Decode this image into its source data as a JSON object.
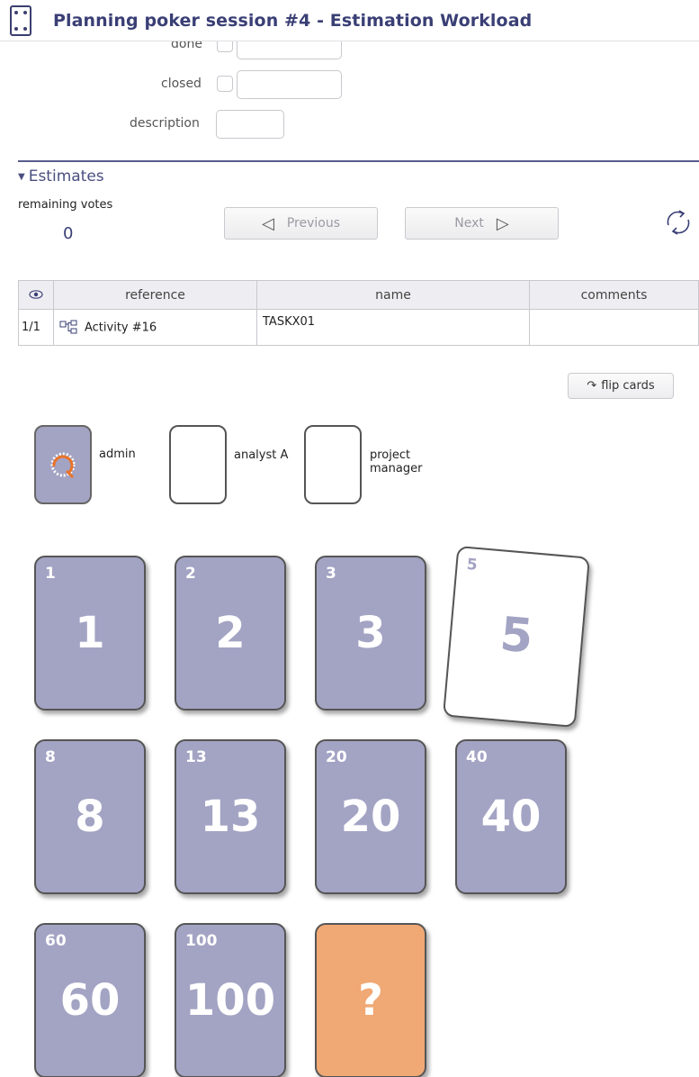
{
  "header": {
    "title": "Planning poker session  #4  - Estimation Workload"
  },
  "form": {
    "done_label": "done",
    "closed_label": "closed",
    "description_label": "description"
  },
  "estimates": {
    "section_title": "Estimates",
    "remaining_votes_label": "remaining votes",
    "remaining_votes_count": "0",
    "previous_label": "Previous",
    "next_label": "Next",
    "previous_arrow": "◁",
    "next_arrow": "▷"
  },
  "table": {
    "columns": [
      "reference",
      "name",
      "comments"
    ],
    "eye_icon": "eye-icon",
    "rows": [
      {
        "index": "1/1",
        "reference": "Activity #16",
        "name": "TASKX01",
        "comments": ""
      }
    ]
  },
  "flip_cards": {
    "label": "flip cards",
    "icon": "↷"
  },
  "participants": [
    {
      "name": "admin",
      "voted": true
    },
    {
      "name": "analyst A",
      "voted": false
    },
    {
      "name": "project manager",
      "voted": false
    }
  ],
  "cards": [
    {
      "corner": "1",
      "value": "1",
      "style": "normal"
    },
    {
      "corner": "2",
      "value": "2",
      "style": "normal"
    },
    {
      "corner": "3",
      "value": "3",
      "style": "normal"
    },
    {
      "corner": "5",
      "value": "5",
      "style": "selected"
    },
    {
      "corner": "8",
      "value": "8",
      "style": "normal"
    },
    {
      "corner": "13",
      "value": "13",
      "style": "normal"
    },
    {
      "corner": "20",
      "value": "20",
      "style": "normal"
    },
    {
      "corner": "40",
      "value": "40",
      "style": "normal"
    },
    {
      "corner": "60",
      "value": "60",
      "style": "normal"
    },
    {
      "corner": "100",
      "value": "100",
      "style": "normal"
    },
    {
      "corner": "",
      "value": "?",
      "style": "unknown"
    }
  ],
  "colors": {
    "title": "#3a3f75",
    "card_default": "#a3a3c4",
    "card_unknown": "#f0a874",
    "section_line": "#585c8c"
  }
}
